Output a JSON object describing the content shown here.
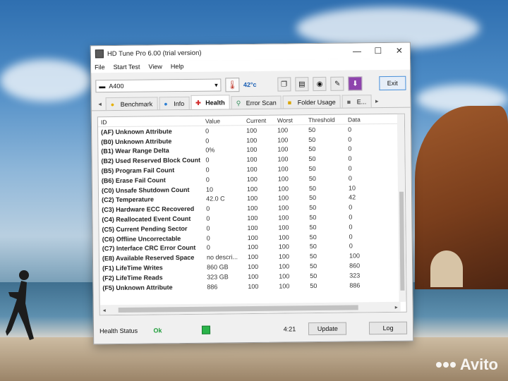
{
  "window": {
    "title": "HD Tune Pro 6.00 (trial version)",
    "controls": {
      "minimize": "—",
      "maximize": "☐",
      "close": "✕"
    }
  },
  "menu": [
    "File",
    "Start Test",
    "View",
    "Help"
  ],
  "toolbar": {
    "drive": "A400",
    "temperature": "42°c",
    "exit_label": "Exit"
  },
  "tabs": [
    {
      "label": "Benchmark",
      "icon": "bulb-icon",
      "active": false
    },
    {
      "label": "Info",
      "icon": "info-icon",
      "active": false
    },
    {
      "label": "Health",
      "icon": "health-cross-icon",
      "active": true
    },
    {
      "label": "Error Scan",
      "icon": "magnifier-icon",
      "active": false
    },
    {
      "label": "Folder Usage",
      "icon": "folder-icon",
      "active": false
    },
    {
      "label": "E...",
      "icon": "erase-icon",
      "active": false
    }
  ],
  "grid": {
    "columns": [
      "ID",
      "Value",
      "Current",
      "Worst",
      "Threshold",
      "Data"
    ],
    "rows": [
      [
        "(AF) Unknown Attribute",
        "0",
        "100",
        "100",
        "50",
        "0"
      ],
      [
        "(B0) Unknown Attribute",
        "0",
        "100",
        "100",
        "50",
        "0"
      ],
      [
        "(B1) Wear Range Delta",
        "0%",
        "100",
        "100",
        "50",
        "0"
      ],
      [
        "(B2) Used Reserved Block Count",
        "0",
        "100",
        "100",
        "50",
        "0"
      ],
      [
        "(B5) Program Fail Count",
        "0",
        "100",
        "100",
        "50",
        "0"
      ],
      [
        "(B6) Erase Fail Count",
        "0",
        "100",
        "100",
        "50",
        "0"
      ],
      [
        "(C0) Unsafe Shutdown Count",
        "10",
        "100",
        "100",
        "50",
        "10"
      ],
      [
        "(C2) Temperature",
        "42.0 C",
        "100",
        "100",
        "50",
        "42"
      ],
      [
        "(C3) Hardware ECC Recovered",
        "0",
        "100",
        "100",
        "50",
        "0"
      ],
      [
        "(C4) Reallocated Event Count",
        "0",
        "100",
        "100",
        "50",
        "0"
      ],
      [
        "(C5) Current Pending Sector",
        "0",
        "100",
        "100",
        "50",
        "0"
      ],
      [
        "(C6) Offline Uncorrectable",
        "0",
        "100",
        "100",
        "50",
        "0"
      ],
      [
        "(C7) Interface CRC Error Count",
        "0",
        "100",
        "100",
        "50",
        "0"
      ],
      [
        "(E8) Available Reserved Space",
        "no descri...",
        "100",
        "100",
        "50",
        "100"
      ],
      [
        "(F1) LifeTime Writes",
        "860 GB",
        "100",
        "100",
        "50",
        "860"
      ],
      [
        "(F2) LifeTime Reads",
        "323 GB",
        "100",
        "100",
        "50",
        "323"
      ],
      [
        "(F5) Unknown Attribute",
        "886",
        "100",
        "100",
        "50",
        "886"
      ]
    ]
  },
  "status": {
    "label": "Health Status",
    "value": "Ok",
    "time": "4:21",
    "update_label": "Update",
    "log_label": "Log"
  },
  "watermark": {
    "text": "Avito"
  }
}
